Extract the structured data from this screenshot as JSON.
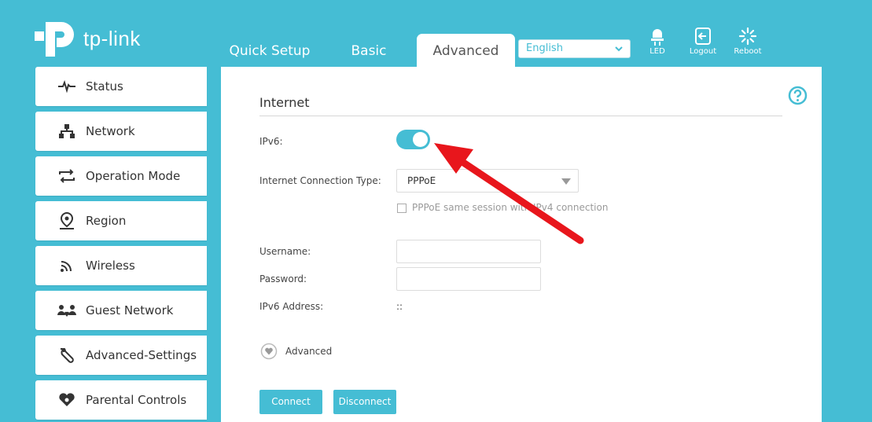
{
  "brand": {
    "name": "tp-link"
  },
  "header": {
    "tabs": [
      {
        "label": "Quick Setup"
      },
      {
        "label": "Basic"
      },
      {
        "label": "Advanced",
        "active": true
      }
    ],
    "language": {
      "selected": "English"
    },
    "buttons": [
      {
        "label": "LED",
        "icon": "led-icon"
      },
      {
        "label": "Logout",
        "icon": "logout-icon"
      },
      {
        "label": "Reboot",
        "icon": "reboot-icon"
      }
    ]
  },
  "sidebar": {
    "items": [
      {
        "label": "Status",
        "icon": "pulse-icon"
      },
      {
        "label": "Network",
        "icon": "network-icon"
      },
      {
        "label": "Operation Mode",
        "icon": "operation-mode-icon"
      },
      {
        "label": "Region",
        "icon": "location-pin-icon"
      },
      {
        "label": "Wireless",
        "icon": "wireless-icon"
      },
      {
        "label": "Guest Network",
        "icon": "guest-users-icon"
      },
      {
        "label": "Advanced-Settings",
        "icon": "wrench-icon"
      },
      {
        "label": "Parental Controls",
        "icon": "heart-icon"
      }
    ]
  },
  "main": {
    "section_title": "Internet",
    "ipv6": {
      "label": "IPv6:",
      "enabled": true
    },
    "connection_type": {
      "label": "Internet Connection Type:",
      "value": "PPPoE"
    },
    "same_session": {
      "label": "PPPoE same session with IPv4 connection",
      "checked": false
    },
    "username": {
      "label": "Username:",
      "value": ""
    },
    "password": {
      "label": "Password:",
      "value": ""
    },
    "ipv6_address": {
      "label": "IPv6 Address:",
      "value": "::"
    },
    "advanced_toggle": {
      "label": "Advanced"
    },
    "buttons": {
      "connect": "Connect",
      "disconnect": "Disconnect"
    }
  },
  "colors": {
    "accent": "#45bdd4",
    "annotation": "#e8161c"
  }
}
